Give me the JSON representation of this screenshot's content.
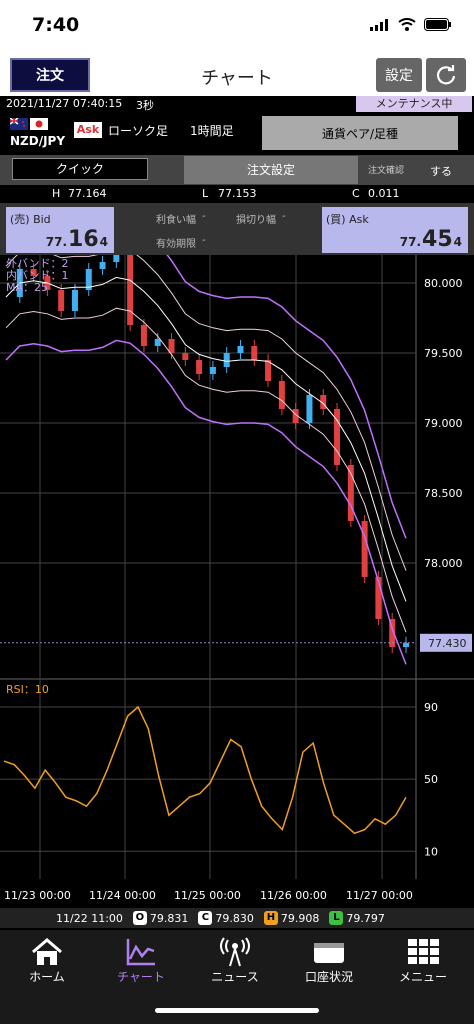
{
  "status": {
    "time": "7:40"
  },
  "header": {
    "order_btn": "注文",
    "title": "チャート",
    "settings_btn": "設定"
  },
  "info": {
    "datetime": "2021/11/27 07:40:15",
    "interval": "3秒",
    "maintenance": "メンテナンス中"
  },
  "symbol": {
    "pair": "NZD/JPY",
    "side": "Ask",
    "chart_type": "ローソク足",
    "timeframe": "1時間足",
    "pair_button": "通貨ペア/足種"
  },
  "order": {
    "quick": "クイック",
    "settings": "注文設定",
    "confirm_label": "注文確認",
    "confirm_value": "する"
  },
  "hlc": {
    "h_label": "H",
    "h": "77.164",
    "l_label": "L",
    "l": "77.153",
    "c_label": "C",
    "c": "0.011"
  },
  "bid": {
    "label": "(売) Bid",
    "p1": "77.",
    "p2": "16",
    "p3": "4"
  },
  "ask": {
    "label": "(買) Ask",
    "p1": "77.",
    "p2": "45",
    "p3": "4"
  },
  "mid": {
    "take_profit": "利食い幅",
    "stop_loss": "損切り幅",
    "expiry": "有効期限",
    "dash": "-"
  },
  "chart_data": [
    {
      "type": "line",
      "title": "",
      "legend": [
        "外バンド：2",
        "内バンド：1",
        "MA：25"
      ],
      "ylim": [
        77.2,
        80.2
      ],
      "y_ticks": [
        "80.000",
        "79.500",
        "79.000",
        "78.500",
        "78.000"
      ],
      "current_price": "77.430",
      "series": [
        {
          "name": "close",
          "values": [
            79.9,
            80.1,
            80.05,
            79.95,
            79.8,
            79.95,
            80.1,
            80.15,
            80.2,
            79.7,
            79.55,
            79.6,
            79.5,
            79.45,
            79.35,
            79.4,
            79.5,
            79.55,
            79.45,
            79.3,
            79.1,
            79.0,
            79.2,
            79.1,
            78.7,
            78.3,
            77.9,
            77.6,
            77.4,
            77.43
          ]
        }
      ]
    },
    {
      "type": "line",
      "title": "RSI：10",
      "ylim": [
        0,
        100
      ],
      "y_ticks": [
        "90",
        "50",
        "10"
      ],
      "x_ticks": [
        "11/23 00:00",
        "11/24 00:00",
        "11/25 00:00",
        "11/26 00:00",
        "11/27 00:00"
      ],
      "series": [
        {
          "name": "RSI",
          "values": [
            60,
            58,
            52,
            45,
            55,
            48,
            40,
            38,
            35,
            42,
            55,
            70,
            85,
            90,
            78,
            52,
            30,
            35,
            40,
            42,
            48,
            60,
            72,
            68,
            50,
            35,
            28,
            22,
            40,
            65,
            70,
            48,
            30,
            25,
            20,
            22,
            28,
            25,
            30,
            40
          ]
        }
      ]
    }
  ],
  "ohlc_footer": {
    "time": "11/22 11:00",
    "o_label": "O",
    "o": "79.831",
    "c_label": "C",
    "c": "79.830",
    "h_label": "H",
    "h": "79.908",
    "l_label": "L",
    "l": "79.797"
  },
  "tabs": [
    {
      "label": "ホーム",
      "icon": "home-icon"
    },
    {
      "label": "チャート",
      "icon": "chart-icon"
    },
    {
      "label": "ニュース",
      "icon": "broadcast-icon"
    },
    {
      "label": "口座状況",
      "icon": "wallet-icon"
    },
    {
      "label": "メニュー",
      "icon": "grid-icon"
    }
  ],
  "colors": {
    "accent": "#b080f0",
    "bid_ask_bg": "#b8b8ec",
    "rsi": "#f0a020",
    "band": "#c070ff",
    "up": "#40b0f0",
    "down": "#e04040"
  }
}
